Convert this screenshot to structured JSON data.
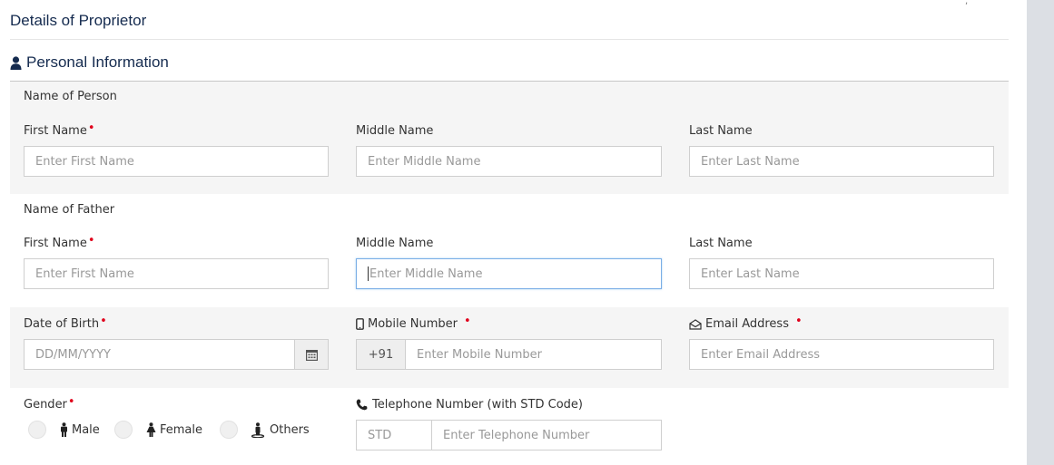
{
  "header": {
    "title": "Details of Proprietor"
  },
  "personal": {
    "title": "Personal Information",
    "icon": "user-icon"
  },
  "person_name": {
    "group_label": "Name of Person",
    "first": {
      "label": "First Name",
      "placeholder": "Enter First Name",
      "required": true
    },
    "middle": {
      "label": "Middle Name",
      "placeholder": "Enter Middle Name"
    },
    "last": {
      "label": "Last Name",
      "placeholder": "Enter Last Name"
    }
  },
  "father_name": {
    "group_label": "Name of Father",
    "first": {
      "label": "First Name",
      "placeholder": "Enter First Name",
      "required": true
    },
    "middle": {
      "label": "Middle Name",
      "placeholder": "Enter Middle Name",
      "focused": true
    },
    "last": {
      "label": "Last Name",
      "placeholder": "Enter Last Name"
    }
  },
  "dob": {
    "label": "Date of Birth",
    "placeholder": "DD/MM/YYYY",
    "icon": "calendar-icon",
    "required": true
  },
  "mobile": {
    "label": "Mobile Number",
    "prefix": "+91",
    "placeholder": "Enter Mobile Number",
    "icon": "mobile-icon",
    "required": true
  },
  "email": {
    "label": "Email Address",
    "placeholder": "Enter Email Address",
    "icon": "envelope-open-icon",
    "required": true
  },
  "gender": {
    "label": "Gender",
    "required": true,
    "options": [
      {
        "label": "Male",
        "icon": "male-icon"
      },
      {
        "label": "Female",
        "icon": "female-icon"
      },
      {
        "label": "Others",
        "icon": "others-icon"
      }
    ]
  },
  "telephone": {
    "label": "Telephone Number (with STD Code)",
    "std_placeholder": "STD",
    "placeholder": "Enter Telephone Number",
    "icon": "phone-icon"
  },
  "required_mark": "•",
  "colors": {
    "heading": "#152b4f",
    "required": "#e0001b",
    "band": "#f5f5f5",
    "focus_border": "#7aaee6"
  }
}
